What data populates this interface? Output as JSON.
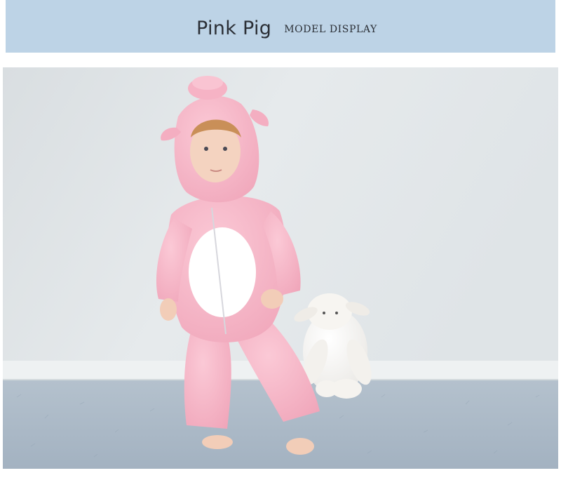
{
  "header": {
    "title": "Pink Pig",
    "subtitle": "MODEL DISPLAY",
    "background_color": "#bdd3e6"
  },
  "photo": {
    "subject": "toddler-in-pink-pig-onesie",
    "prop": "white-plush-lamb",
    "colors": {
      "wall": "#e4e8ea",
      "rug": "#aab9c8",
      "onesie": "#f6b8c9",
      "belly": "#ffffff"
    }
  }
}
